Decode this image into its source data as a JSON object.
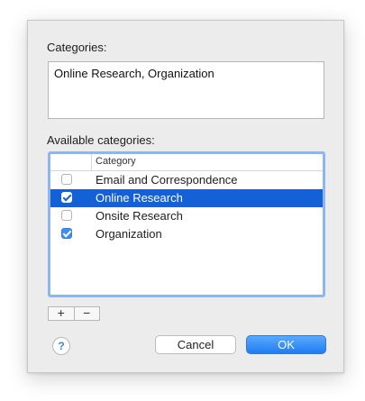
{
  "dialog": {
    "categories_label": "Categories:",
    "categories_value": "Online Research, Organization",
    "available_label": "Available categories:",
    "table": {
      "column_header": "Category",
      "rows": [
        {
          "label": "Email and Correspondence",
          "checked": false,
          "selected": false
        },
        {
          "label": "Online Research",
          "checked": true,
          "selected": true
        },
        {
          "label": "Onsite Research",
          "checked": false,
          "selected": false
        },
        {
          "label": "Organization",
          "checked": true,
          "selected": false
        }
      ]
    },
    "add_label": "+",
    "remove_label": "−",
    "help_label": "?",
    "cancel_label": "Cancel",
    "ok_label": "OK"
  },
  "colors": {
    "selection": "#1460d6",
    "accent": "#3b8ff5"
  }
}
